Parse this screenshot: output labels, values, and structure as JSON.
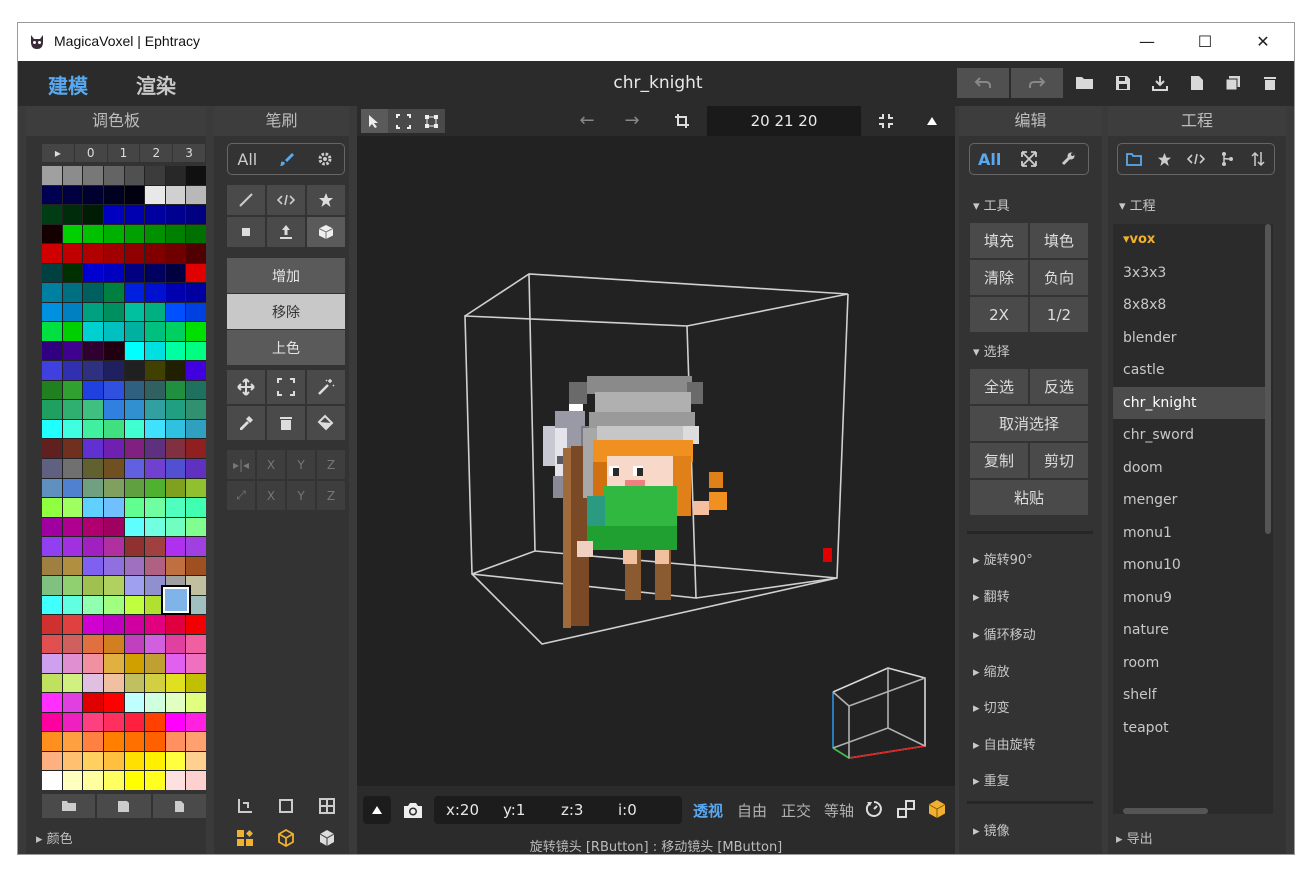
{
  "window": {
    "title": "MagicaVoxel | Ephtracy",
    "minimize": "—",
    "maximize": "☐",
    "close": "✕"
  },
  "topbar": {
    "mode_model": "建模",
    "mode_render": "渲染",
    "document": "chr_knight"
  },
  "palette": {
    "title": "调色板",
    "tabs": [
      "▸",
      "0",
      "1",
      "2",
      "3"
    ],
    "footer_label": "▸ 颜色",
    "selected_color": "#7fb4e8",
    "colors": [
      "#a0a0a0",
      "#8c8c8c",
      "#787878",
      "#646464",
      "#505050",
      "#3c3c3c",
      "#282828",
      "#101010",
      "#000050",
      "#000040",
      "#000030",
      "#000020",
      "#000010",
      "#e8e8e8",
      "#d0d0d0",
      "#b8b8b8",
      "#003c14",
      "#002c0c",
      "#001c04",
      "#0000c0",
      "#0000b0",
      "#0000a0",
      "#000090",
      "#000080",
      "#140000",
      "#00d000",
      "#00c000",
      "#00b000",
      "#00a000",
      "#009000",
      "#008000",
      "#007000",
      "#d00000",
      "#c00000",
      "#b00000",
      "#a00000",
      "#900000",
      "#800000",
      "#700000",
      "#500000",
      "#004040",
      "#003000",
      "#0000d0",
      "#0000c0",
      "#000080",
      "#000060",
      "#000040",
      "#e00000",
      "#0080a0",
      "#007080",
      "#006060",
      "#008040",
      "#0020e0",
      "#0010d0",
      "#0000b0",
      "#0000a0",
      "#0090e0",
      "#0080c0",
      "#00a080",
      "#009060",
      "#00c0a0",
      "#00b080",
      "#0050ff",
      "#0040e0",
      "#00e040",
      "#00d000",
      "#00d0d0",
      "#00c0c0",
      "#00b0a0",
      "#00c080",
      "#00d060",
      "#00e000",
      "#300080",
      "#400090",
      "#300030",
      "#200010",
      "#00ffff",
      "#00e0e0",
      "#00ffa0",
      "#00ff80",
      "#4040e0",
      "#3030b0",
      "#303080",
      "#202060",
      "#202020",
      "#404000",
      "#202000",
      "#4000e0",
      "#208020",
      "#30a030",
      "#2040e0",
      "#3050e0",
      "#306080",
      "#306060",
      "#209040",
      "#207060",
      "#20a060",
      "#30b070",
      "#40c080",
      "#3080e0",
      "#3090d0",
      "#30a0a0",
      "#20a080",
      "#309070",
      "#20ffff",
      "#40ffe0",
      "#40f0a0",
      "#40e080",
      "#40ffd0",
      "#40e0ff",
      "#30c0e0",
      "#30a0c0",
      "#602020",
      "#703020",
      "#6030d0",
      "#7020b0",
      "#802080",
      "#603080",
      "#803040",
      "#902020",
      "#606080",
      "#707070",
      "#606030",
      "#705020",
      "#6060e0",
      "#7040d0",
      "#5050d0",
      "#6030c0",
      "#6090c0",
      "#5080d0",
      "#70a080",
      "#80a060",
      "#60a040",
      "#50b030",
      "#80a020",
      "#90c030",
      "#90ff40",
      "#a0ff60",
      "#60d0ff",
      "#70c0ff",
      "#60ff90",
      "#70ffa0",
      "#50ffc0",
      "#40ffb0",
      "#a000a0",
      "#b00090",
      "#b00070",
      "#a00060",
      "#60ffff",
      "#70ffe0",
      "#70ffc0",
      "#80ff90",
      "#9040f0",
      "#a030e0",
      "#a020c0",
      "#b030a0",
      "#903030",
      "#a04040",
      "#b030f0",
      "#a040e0",
      "#a08040",
      "#b09040",
      "#8060f0",
      "#9070e0",
      "#a070c0",
      "#b06080",
      "#c07040",
      "#a05020",
      "#80c080",
      "#90d070",
      "#a0c050",
      "#b0d060",
      "#a0a0f0",
      "#9090d0",
      "#a0a0a0",
      "#c0c0a0",
      "#40ffff",
      "#60ffe0",
      "#90ffb0",
      "#a0ff80",
      "#c0ff40",
      "#b0e030",
      "#7fb4e8",
      "#a0c0c0",
      "#d03030",
      "#e04040",
      "#d000d0",
      "#c000c0",
      "#d000a0",
      "#e00080",
      "#e00040",
      "#f00000",
      "#e05050",
      "#d06060",
      "#e07040",
      "#d08020",
      "#c040c0",
      "#d060e0",
      "#e040a0",
      "#f060a0",
      "#d0a0f0",
      "#e090d0",
      "#f090a0",
      "#e0b040",
      "#d0a000",
      "#c0a030",
      "#e060f0",
      "#f070c0",
      "#c0e060",
      "#d0f080",
      "#e0c0e0",
      "#f0c0a0",
      "#c0c060",
      "#d0d040",
      "#e0e020",
      "#c0c000",
      "#ff30ff",
      "#e040e0",
      "#e00000",
      "#ff0000",
      "#c0ffff",
      "#d0ffe0",
      "#e0ffc0",
      "#e0ff80",
      "#ff00a0",
      "#f020c0",
      "#ff4080",
      "#ff3060",
      "#ff2040",
      "#ff4000",
      "#ff00ff",
      "#ff20e0",
      "#ff9020",
      "#ffa040",
      "#ff8040",
      "#ff8000",
      "#ff7000",
      "#ff6000",
      "#ff9060",
      "#ffa070",
      "#ffb080",
      "#ffc070",
      "#ffd060",
      "#ffc040",
      "#ffe000",
      "#fff000",
      "#ffff40",
      "#ffd090",
      "#ffffff",
      "#ffffc0",
      "#ffffa0",
      "#ffff60",
      "#ffff00",
      "#ffff20",
      "#ffe0e0",
      "#ffd0d0"
    ]
  },
  "brush": {
    "title": "笔刷",
    "all": "All",
    "modes": [
      "增加",
      "移除",
      "上色"
    ],
    "axes_row1": [
      "X",
      "Y",
      "Z"
    ],
    "axes_row2": [
      "X",
      "Y",
      "Z"
    ]
  },
  "viewport": {
    "coords": "20 21 20",
    "stats": {
      "x": "x:20",
      "y": "y:1",
      "z": "z:3",
      "i": "i:0"
    },
    "projections": [
      "透视",
      "自由",
      "正交",
      "等轴"
    ],
    "active_projection": "透视",
    "hint": "旋转镜头 [RButton] : 移动镜头 [MButton]"
  },
  "edit": {
    "title": "编辑",
    "all": "All",
    "tools_label": "▾ 工具",
    "tools": [
      "填充",
      "填色",
      "清除",
      "负向",
      "2X",
      "1/2"
    ],
    "select_label": "▾ 选择",
    "select_all": "全选",
    "invert": "反选",
    "deselect": "取消选择",
    "copy": "复制",
    "cut": "剪切",
    "paste": "粘贴",
    "sections": [
      "▸ 旋转90°",
      "▸ 翻转",
      "▸ 循环移动",
      "▸ 缩放",
      "▸ 切变",
      "▸ 自由旋转",
      "▸ 重复"
    ],
    "mirror": "▸ 镜像"
  },
  "project": {
    "title": "工程",
    "section": "▾ 工程",
    "folder": "▾vox",
    "items": [
      "3x3x3",
      "8x8x8",
      "blender",
      "castle",
      "chr_knight",
      "chr_sword",
      "doom",
      "menger",
      "monu1",
      "monu10",
      "monu9",
      "nature",
      "room",
      "shelf",
      "teapot"
    ],
    "selected": "chr_knight",
    "export": "▸ 导出"
  },
  "colors": {
    "accent": "#5aa9f0",
    "folder": "#f0b030",
    "panel": "#333333",
    "viewport": "#222222"
  }
}
